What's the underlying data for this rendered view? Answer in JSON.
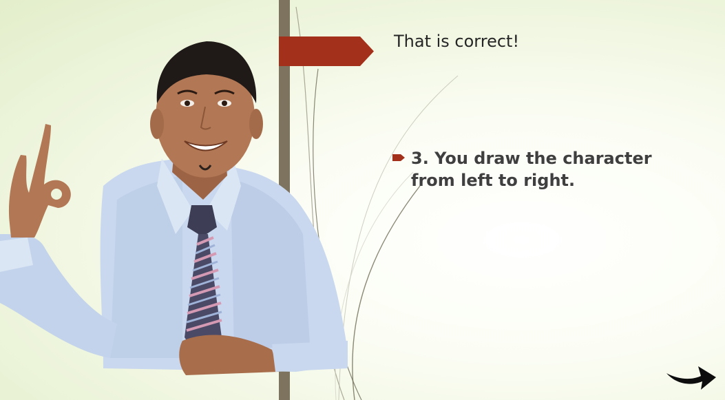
{
  "slide": {
    "title": "That is correct!",
    "bullet_text": "3. You draw the character from left to right."
  },
  "colors": {
    "accent": "#a3301a",
    "bar": "#7d735f",
    "background": "#eef5dd",
    "text": "#3f3f3f"
  },
  "icons": {
    "bullet": "right-arrow-bullet-icon",
    "next": "curved-right-arrow-icon"
  }
}
